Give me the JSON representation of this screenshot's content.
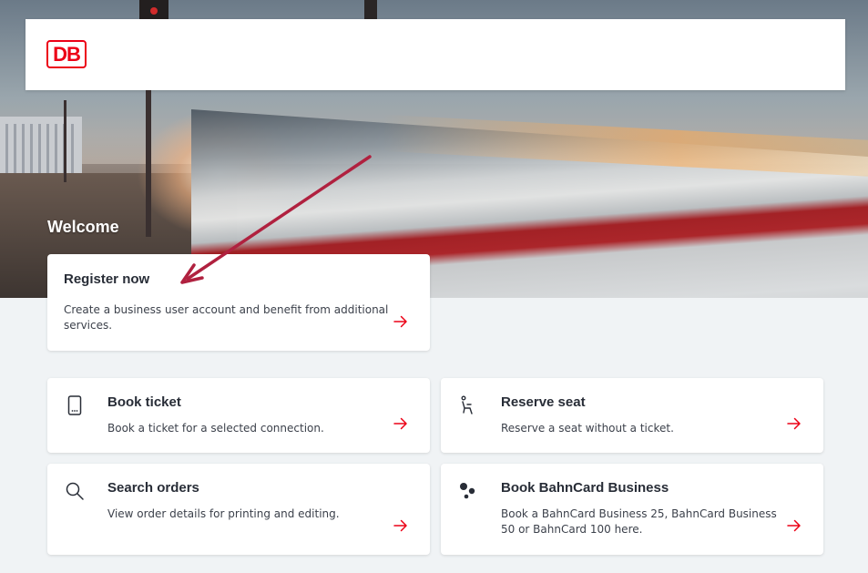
{
  "brand": {
    "logo_text": "DB",
    "accent": "#ec0016",
    "arrow_color": "#b0213f"
  },
  "hero": {
    "welcome": "Welcome"
  },
  "register": {
    "title": "Register now",
    "description": "Create a business user account and benefit from additional services."
  },
  "tiles": [
    {
      "title": "Book ticket",
      "description": "Book a ticket for a selected connection.",
      "icon": "mobile-phone-icon"
    },
    {
      "title": "Reserve seat",
      "description": "Reserve a seat without a ticket.",
      "icon": "seat-icon"
    },
    {
      "title": "Search orders",
      "description": "View order details for printing and editing.",
      "icon": "search-icon"
    },
    {
      "title": "Book BahnCard Business",
      "description": "Book a BahnCard Business 25, BahnCard Business 50 or BahnCard 100 here.",
      "icon": "bahncard-icon"
    }
  ]
}
